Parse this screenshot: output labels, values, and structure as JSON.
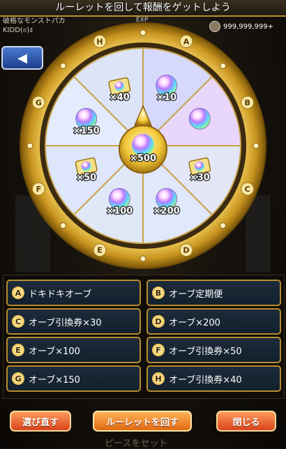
{
  "header": {
    "title": "ルーレットを回して報酬をゲットしよう"
  },
  "player": {
    "subtitle": "破格なモンストパカ",
    "name": "KIDD(ಠ)ง"
  },
  "exp_label": "EXP",
  "coins": "999,999,999+",
  "wheel": {
    "segments": [
      {
        "letter": "A",
        "label": "×10",
        "icon": "orb-icon"
      },
      {
        "letter": "B",
        "label": "",
        "icon": "orb-icon"
      },
      {
        "letter": "C",
        "label": "×30",
        "icon": "ticket-icon"
      },
      {
        "letter": "D",
        "label": "×200",
        "icon": "orb-icon"
      },
      {
        "letter": "E",
        "label": "×100",
        "icon": "orb-icon"
      },
      {
        "letter": "F",
        "label": "×50",
        "icon": "ticket-icon"
      },
      {
        "letter": "G",
        "label": "×150",
        "icon": "orb-icon"
      },
      {
        "letter": "H",
        "label": "×40",
        "icon": "ticket-icon"
      }
    ],
    "center_label": "×500"
  },
  "options": [
    {
      "letter": "A",
      "label": "ドキドキオーブ"
    },
    {
      "letter": "B",
      "label": "オーブ定期便"
    },
    {
      "letter": "C",
      "label": "オーブ引換券×30"
    },
    {
      "letter": "D",
      "label": "オーブ×200"
    },
    {
      "letter": "E",
      "label": "オーブ×100"
    },
    {
      "letter": "F",
      "label": "オーブ引換券×50"
    },
    {
      "letter": "G",
      "label": "オーブ×150"
    },
    {
      "letter": "H",
      "label": "オーブ引換券×40"
    }
  ],
  "buttons": {
    "reselect": "選び直す",
    "spin": "ルーレットを回す",
    "close": "閉じる"
  },
  "footer": "ピースをセット"
}
